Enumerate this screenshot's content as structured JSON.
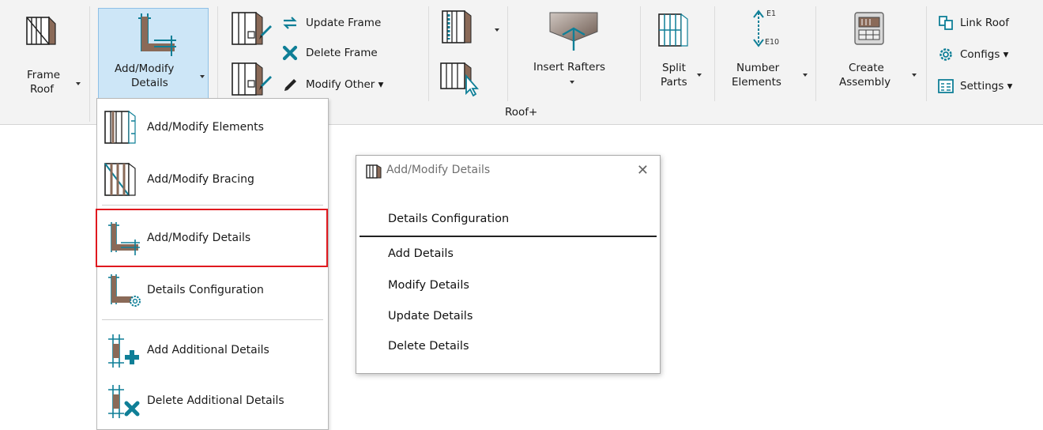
{
  "ribbon": {
    "frame_roof": {
      "line1": "Frame",
      "line2": "Roof"
    },
    "add_modify_details": {
      "line1": "Add/Modify",
      "line2": "Details"
    },
    "frame_ops": {
      "update": "Update Frame",
      "delete": "Delete Frame",
      "modify_other": "Modify Other ▾"
    },
    "insert_rafters": "Insert Rafters",
    "split_parts": {
      "line1": "Split",
      "line2": "Parts"
    },
    "number_elements": {
      "line1": "Number",
      "line2": "Elements",
      "tag_top": "E1",
      "tag_bottom": "E10"
    },
    "create_assembly": {
      "line1": "Create",
      "line2": "Assembly"
    },
    "right_tools": {
      "link_roof": "Link Roof",
      "configs": "Configs ▾",
      "settings": "Settings ▾"
    },
    "group_label": "Roof+"
  },
  "menu": {
    "items": [
      {
        "label": "Add/Modify  Elements"
      },
      {
        "label": "Add/Modify  Bracing"
      },
      {
        "label": "Add/Modify  Details"
      },
      {
        "label": "Details  Configuration"
      },
      {
        "label": "Add Additional  Details"
      },
      {
        "label": "Delete Additional  Details"
      }
    ]
  },
  "dialog": {
    "title": "Add/Modify Details",
    "close": "✕",
    "items": [
      "Details Configuration",
      "Add Details",
      "Modify Details",
      "Update Details",
      "Delete Details"
    ]
  },
  "colors": {
    "accent_teal": "#0f7f97",
    "wood": "#8a6a58",
    "highlight_red": "#e0191f",
    "ribbon_bg": "#f3f3f3"
  }
}
